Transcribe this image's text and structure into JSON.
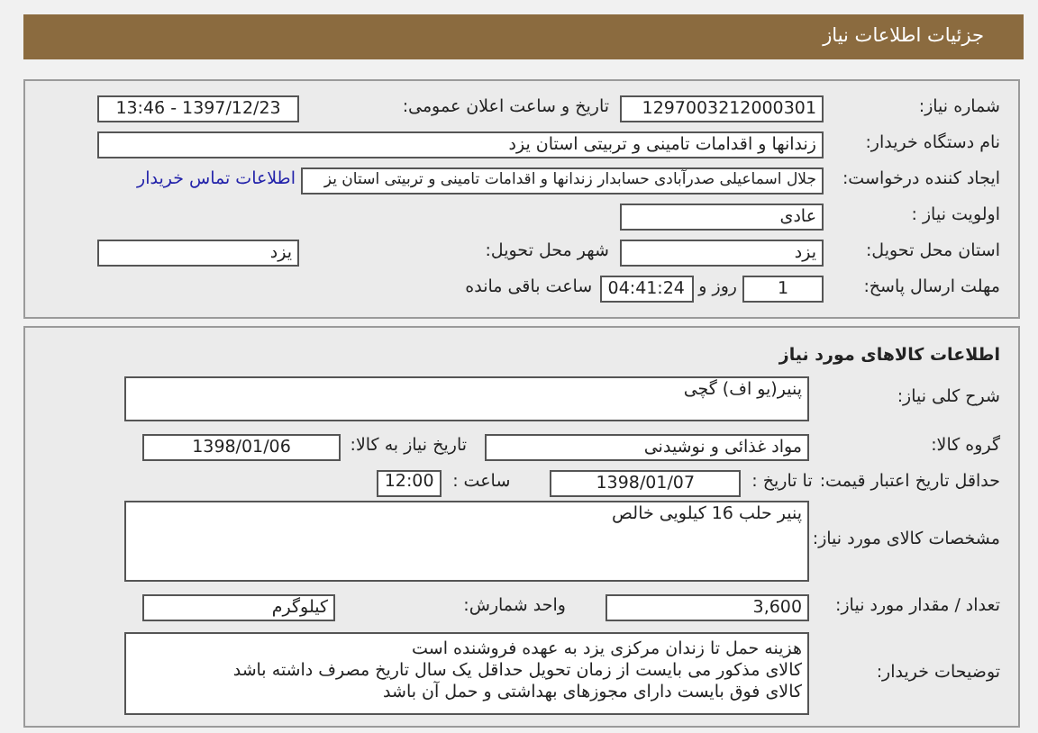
{
  "header": {
    "title": "جزئیات اطلاعات نیاز"
  },
  "request": {
    "need_number_label": "شماره نیاز:",
    "need_number": "1297003212000301",
    "announce_label": "تاریخ و ساعت اعلان عمومی:",
    "announce_datetime": "1397/12/23 - 13:46",
    "buyer_label": "نام دستگاه خریدار:",
    "buyer": "زندانها و اقدامات تامینی و تربیتی استان یزد",
    "creator_label": "ایجاد کننده درخواست:",
    "creator": "جلال اسماعیلی صدرآبادی حسابدار زندانها و اقدامات تامینی و تربیتی استان یز",
    "contact_link": "اطلاعات تماس خریدار",
    "priority_label": "اولویت نیاز :",
    "priority": "عادی",
    "province_label": "استان محل تحویل:",
    "province": "یزد",
    "city_label": "شهر محل تحویل:",
    "city": "یزد",
    "deadline_label": "مهلت ارسال پاسخ:",
    "days": "1",
    "days_unit": "روز و",
    "time_left": "04:41:24",
    "time_left_suffix": "ساعت باقی مانده"
  },
  "goods": {
    "title": "اطلاعات کالاهای مورد نیاز",
    "summary_label": "شرح کلی نیاز:",
    "summary": "پنیر(یو اف) گچی",
    "group_label": "گروه کالا:",
    "group": "مواد غذائی و نوشیدنی",
    "need_date_label": "تاریخ نیاز به کالا:",
    "need_date": "1398/01/06",
    "validity_label": "حداقل تاریخ اعتبار قیمت:",
    "until_label": "تا تاریخ :",
    "until_date": "1398/01/07",
    "hour_label": "ساعت :",
    "hour": "12:00",
    "spec_label": "مشخصات کالای مورد نیاز:",
    "spec": "پنیر حلب 16 کیلویی خالص",
    "qty_label": "تعداد / مقدار مورد نیاز:",
    "qty": "3,600",
    "unit_label": "واحد شمارش:",
    "unit": "کیلوگرم",
    "notes_label": "توضیحات خریدار:",
    "notes": [
      "هزینه حمل تا زندان مرکزی یزد به عهده فروشنده است",
      "کالای مذکور می بایست از زمان تحویل حداقل یک سال تاریخ مصرف داشته باشد",
      "کالای فوق بایست دارای مجوزهای بهداشتی و حمل آن باشد"
    ]
  }
}
